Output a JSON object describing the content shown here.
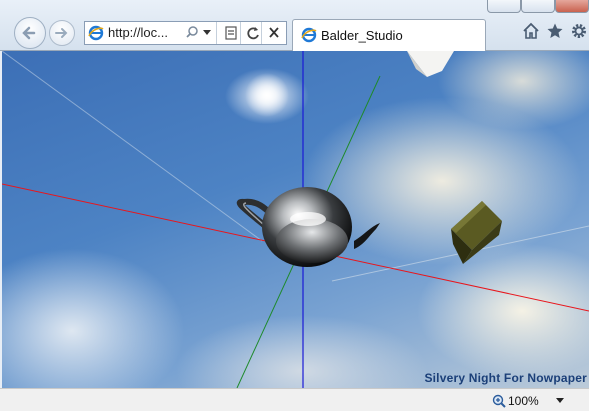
{
  "browser": {
    "address": {
      "url": "http://loc..."
    },
    "tab": {
      "title": "Balder_Studio"
    }
  },
  "status": {
    "zoom": "100%"
  },
  "content": {
    "watermark": "Silvery Night For Nowpaper"
  },
  "colors": {
    "x_axis": "#e8161c",
    "y_axis": "#1a1ad6",
    "z_axis": "#1e8a2a"
  }
}
